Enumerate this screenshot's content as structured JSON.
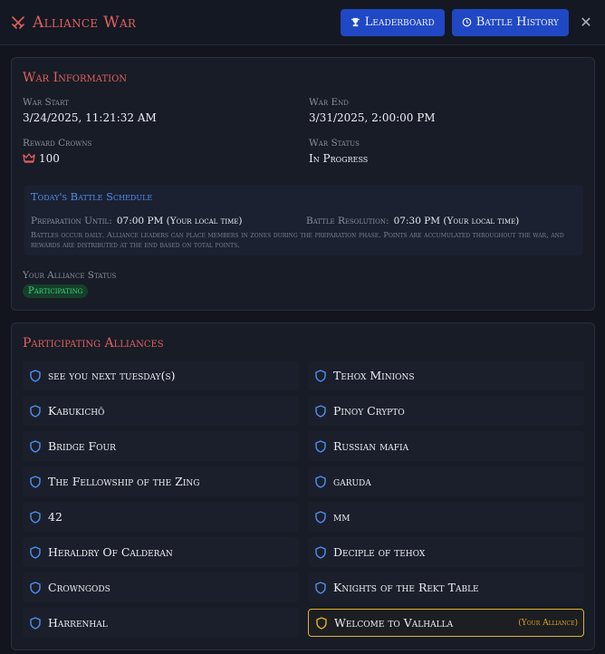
{
  "header": {
    "title": "Alliance War",
    "leaderboard_label": "Leaderboard",
    "history_label": "Battle History",
    "close_glyph": "✕"
  },
  "war_info": {
    "title": "War Information",
    "start_label": "War Start",
    "start_value": "3/24/2025, 11:21:32 AM",
    "end_label": "War End",
    "end_value": "3/31/2025, 2:00:00 PM",
    "crowns_label": "Reward Crowns",
    "crowns_value": "100",
    "status_label": "War Status",
    "status_value": "In Progress",
    "schedule": {
      "title": "Today's Battle Schedule",
      "prep_label": "Preparation Until:",
      "prep_value": "07:00 PM (Your local time)",
      "resolution_label": "Battle Resolution:",
      "resolution_value": "07:30 PM (Your local time)",
      "description": "Battles occur daily. Alliance leaders can place members in zones during the preparation phase. Points are accumulated throughout the war, and rewards are distributed at the end based on total points."
    },
    "alliance_status_label": "Your Alliance Status",
    "alliance_status_value": "Participating"
  },
  "alliances": {
    "title": "Participating Alliances",
    "your_alliance_tag": "(Your Alliance)",
    "left": [
      "see you next tuesday(s)",
      "Kabukichō",
      "Bridge Four",
      "The Fellowship of the Zing",
      "42",
      "Heraldry Of Calderan",
      "Crowngods",
      "Harrenhal"
    ],
    "right": [
      "Tehox Minions",
      "Pinoy Crypto",
      "Russian mafia",
      "garuda",
      "mm",
      "Deciple of tehox",
      "Knights of the Rekt Table",
      "Welcome to Valhalla"
    ]
  },
  "colors": {
    "accent_red": "#e0605f",
    "button_blue": "#2047c4",
    "shield_blue": "#4f8ff0",
    "gold": "#e0b32a",
    "success_green": "#3fd27e"
  }
}
